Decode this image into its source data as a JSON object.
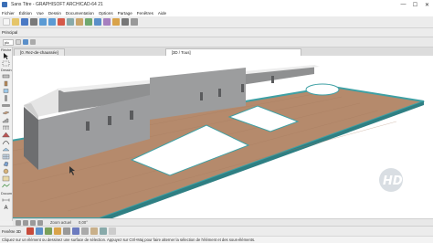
{
  "window": {
    "title": "Sans Titre - GRAPHISOFT ARCHICAD-64 21",
    "controls": {
      "minimize": "—",
      "maximize": "☐",
      "close": "✕"
    }
  },
  "menu": {
    "items": [
      "Fichier",
      "Édition",
      "Vue",
      "Dessin",
      "Documentation",
      "Options",
      "Partage",
      "Fenêtres",
      "Aide"
    ]
  },
  "toolbar2": {
    "label": "Principal"
  },
  "infobox": {
    "selected_value": "plc"
  },
  "toolbox": {
    "header": "Flèche",
    "section": "Dessin",
    "doc_section": "Docum"
  },
  "tabs": [
    {
      "label": "[0. Rez-de-chaussée]",
      "active": false
    },
    {
      "label": "[3D / Tous]",
      "active": true
    }
  ],
  "navbar": {
    "zoom": "Zoom actuel",
    "angle": "0,00°"
  },
  "docbar": {
    "label": "Fenêtre 3D"
  },
  "status": {
    "text": "Cliquez sur un élément ou dessinez une surface de sélection. Appuyez sur Ctrl+Maj pour faire alterner la sélection de l'élément et des sous-éléments."
  },
  "watermark": {
    "text": "HD"
  },
  "colors": {
    "floor": "#b58a6c",
    "floor_edge": "#3ea0a4",
    "wall": "#9a9a9c",
    "wall_top": "#ededed",
    "accent": "#3b6fb6"
  }
}
